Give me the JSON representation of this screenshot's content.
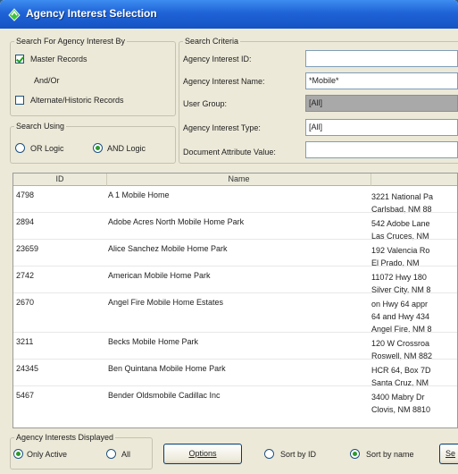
{
  "window": {
    "title": "Agency Interest Selection",
    "icon": "app-icon"
  },
  "search_for": {
    "group_label": "Search For Agency Interest By",
    "master_records": {
      "label": "Master Records",
      "checked": true
    },
    "and_or": "And/Or",
    "alternate_records": {
      "label": "Alternate/Historic Records",
      "checked": false
    }
  },
  "search_using": {
    "group_label": "Search Using",
    "or_logic": {
      "label": "OR Logic",
      "selected": false
    },
    "and_logic": {
      "label": "AND Logic",
      "selected": true
    }
  },
  "criteria": {
    "group_label": "Search Criteria",
    "agency_interest_id": {
      "label": "Agency Interest ID:",
      "value": ""
    },
    "agency_interest_name": {
      "label": "Agency Interest Name:",
      "value": "*Mobile*"
    },
    "user_group": {
      "label": "User Group:",
      "value": "[All]"
    },
    "agency_interest_type": {
      "label": "Agency Interest Type:",
      "value": "[All]"
    },
    "document_attribute_value": {
      "label": "Document Attribute Value:",
      "value": ""
    }
  },
  "results": {
    "columns": [
      "ID",
      "Name",
      ""
    ],
    "rows": [
      {
        "id": "4798",
        "name": "A 1 Mobile Home",
        "address": [
          "3221 National Pa",
          "Carlsbad, NM 88"
        ]
      },
      {
        "id": "2894",
        "name": "Adobe Acres North Mobile Home Park",
        "address": [
          "542 Adobe Lane",
          "Las Cruces, NM"
        ]
      },
      {
        "id": "23659",
        "name": "Alice Sanchez Mobile Home Park",
        "address": [
          "192 Valencia Ro",
          "El Prado, NM"
        ]
      },
      {
        "id": "2742",
        "name": "American Mobile Home Park",
        "address": [
          "11072 Hwy 180",
          "Silver City, NM 8"
        ]
      },
      {
        "id": "2670",
        "name": "Angel Fire Mobile Home Estates",
        "address": [
          "on Hwy 64 appr",
          "64 and Hwy 434",
          "Angel Fire, NM 8"
        ]
      },
      {
        "id": "3211",
        "name": "Becks Mobile Home Park",
        "address": [
          "120 W Crossroa",
          "Roswell, NM 882"
        ]
      },
      {
        "id": "24345",
        "name": "Ben Quintana Mobile Home Park",
        "address": [
          "HCR 64, Box 7D",
          "Santa Cruz, NM"
        ]
      },
      {
        "id": "5467",
        "name": "Bender Oldsmobile Cadillac Inc",
        "address": [
          "3400 Mabry Dr",
          "Clovis, NM 8810"
        ]
      }
    ]
  },
  "footer": {
    "displayed": {
      "group_label": "Agency Interests Displayed",
      "only_active": {
        "label": "Only Active",
        "selected": true
      },
      "all": {
        "label": "All",
        "selected": false
      }
    },
    "options_button": "Options",
    "sort_by_id": {
      "label": "Sort by ID",
      "selected": false
    },
    "sort_by_name": {
      "label": "Sort by name",
      "selected": true
    },
    "partial_button": "Se"
  },
  "colors": {
    "titlebar": "#1f63d6",
    "window_bg": "#ece9d8",
    "selected_radio": "#2c9a2c"
  }
}
